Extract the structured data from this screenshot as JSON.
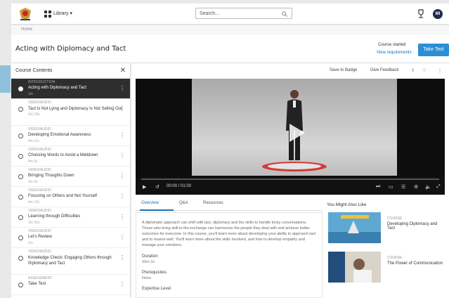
{
  "topbar": {
    "library_label": "Library ▾",
    "search_placeholder": "Search...",
    "avatar_initials": "MI"
  },
  "breadcrumb": "Home",
  "course": {
    "title": "Acting with Diplomacy and Tact",
    "status": "Course started",
    "requirements_link": "View requirements",
    "take_test_label": "Take Test"
  },
  "sidebar": {
    "title": "Course Contents",
    "items": [
      {
        "type": "INTRODUCTION",
        "name": "Acting with Diplomacy and Tact",
        "duration": "1m",
        "active": true
      },
      {
        "type": "VIDEO/AUDIO",
        "name": "Tact Is Not Lying and Diplomacy Is Not Selling Out",
        "duration": "3m 19s"
      },
      {
        "type": "VIDEO/AUDIO",
        "name": "Developing Emotional Awareness",
        "duration": "4m 11s"
      },
      {
        "type": "VIDEO/AUDIO",
        "name": "Choosing Words to Avoid a Meltdown",
        "duration": "4m 5s"
      },
      {
        "type": "VIDEO/AUDIO",
        "name": "Bringing Thoughts Down",
        "duration": "3m 4s"
      },
      {
        "type": "VIDEO/AUDIO",
        "name": "Focusing on Others and Not Yourself",
        "duration": "4m 12s"
      },
      {
        "type": "VIDEO/AUDIO",
        "name": "Learning through Difficulties",
        "duration": "3m 32s"
      },
      {
        "type": "VIDEO/AUDIO",
        "name": "Let's Review",
        "duration": "1m"
      },
      {
        "type": "VIDEO/AUDIO",
        "name": "Knowledge Check: Engaging Others through Diplomacy and Tact",
        "duration": "2m"
      },
      {
        "type": "ASSESSMENT",
        "name": "Take Test",
        "duration": ""
      }
    ]
  },
  "toolbar": {
    "save": "Save to Badge",
    "feedback": "Give Feedback"
  },
  "player": {
    "time": "00:00 / 01:00"
  },
  "tabs": [
    "Overview",
    "Q&A",
    "Resources"
  ],
  "overview": {
    "description": "A diplomatic approach can shift with tact, diplomacy and the skills to handle tricky conversations. Those who bring skill to the exchange can harmonize the people they deal with and achieve better outcomes for everyone. In this course, you'll learn more about developing your ability to approach tact and to reason well. You'll learn more about the skills involved, and how to develop empathy and manage your emotions.",
    "duration_label": "Duration",
    "duration_value": "30m 2s",
    "prereq_label": "Prerequisites",
    "prereq_value": "None",
    "expertise_label": "Expertise Level"
  },
  "you_might_also_like": {
    "title": "You Might Also Like",
    "cards": [
      {
        "type": "COURSE",
        "name": "Developing Diplomacy and Tact"
      },
      {
        "type": "COURSE",
        "name": "The Power of Communication"
      }
    ]
  }
}
